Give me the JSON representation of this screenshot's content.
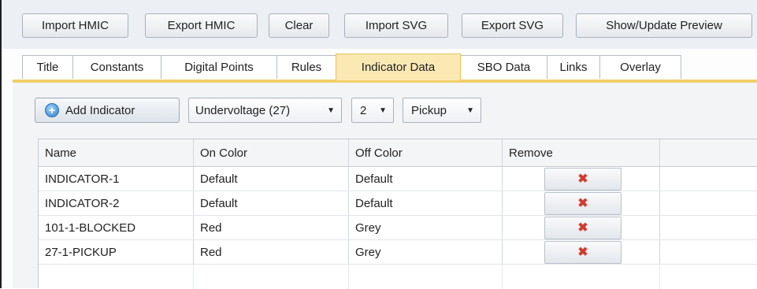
{
  "toolbar": {
    "buttons": [
      {
        "label": "Import HMIC"
      },
      {
        "label": "Export HMIC"
      },
      {
        "label": "Clear"
      },
      {
        "label": "Import SVG"
      },
      {
        "label": "Export SVG"
      },
      {
        "label": "Show/Update Preview"
      }
    ]
  },
  "tabs": [
    {
      "label": "Title"
    },
    {
      "label": "Constants"
    },
    {
      "label": "Digital Points"
    },
    {
      "label": "Rules"
    },
    {
      "label": "Indicator Data",
      "active": true
    },
    {
      "label": "SBO Data"
    },
    {
      "label": "Links"
    },
    {
      "label": "Overlay"
    }
  ],
  "controls": {
    "add_indicator_label": "Add Indicator",
    "type_select": "Undervoltage (27)",
    "number_select": "2",
    "mode_select": "Pickup"
  },
  "grid": {
    "columns": [
      "Name",
      "On Color",
      "Off Color",
      "Remove"
    ],
    "rows": [
      {
        "name": "INDICATOR-1",
        "on_color": "Default",
        "off_color": "Default"
      },
      {
        "name": "INDICATOR-2",
        "on_color": "Default",
        "off_color": "Default"
      },
      {
        "name": "101-1-BLOCKED",
        "on_color": "Red",
        "off_color": "Grey"
      },
      {
        "name": "27-1-PICKUP",
        "on_color": "Red",
        "off_color": "Grey"
      }
    ]
  },
  "icons": {
    "add": "plus-circle-icon",
    "remove": "red-x-icon",
    "dropdown": "caret-down-icon"
  },
  "colors": {
    "active_tab": "#fbe9b4",
    "tab_accent": "#f1cf6a",
    "remove_icon": "#d9372a",
    "add_icon": "#2c7fd0"
  }
}
